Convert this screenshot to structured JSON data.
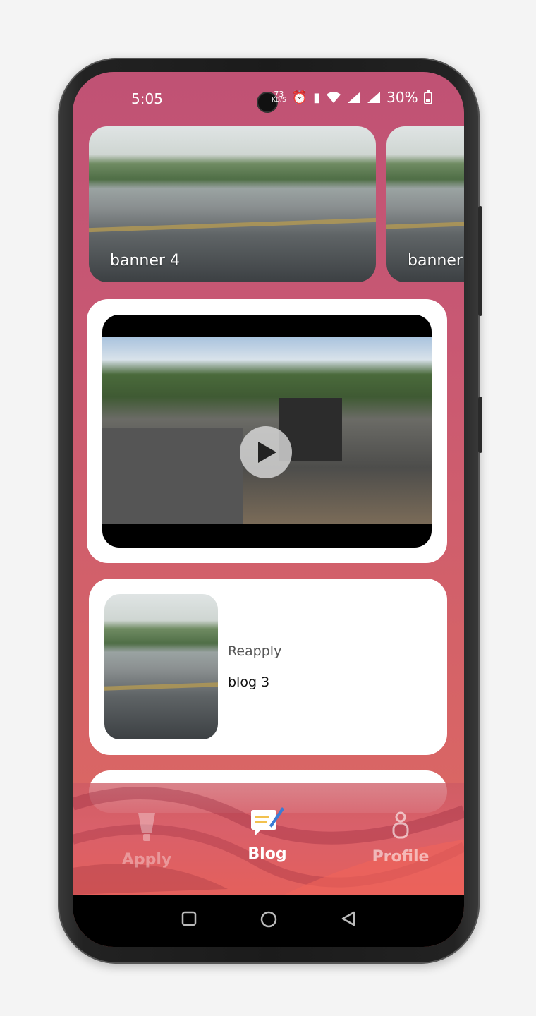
{
  "status_bar": {
    "time": "5:05",
    "speed_value": "73",
    "speed_unit": "KB/S",
    "battery": "30%"
  },
  "banners": [
    {
      "label": "banner 4"
    },
    {
      "label": "banner"
    }
  ],
  "video": {
    "play_icon": "play-icon"
  },
  "blog": {
    "category": "Reapply",
    "title": "blog 3"
  },
  "bottom_nav": {
    "items": [
      {
        "label": "Apply",
        "icon": "lamp-icon",
        "active": false
      },
      {
        "label": "Blog",
        "icon": "chat-pen-icon",
        "active": true
      },
      {
        "label": "Profile",
        "icon": "person-icon",
        "active": false
      }
    ]
  },
  "colors": {
    "screen_top": "#c05274",
    "screen_bottom": "#e06a60",
    "card": "#ffffff"
  }
}
